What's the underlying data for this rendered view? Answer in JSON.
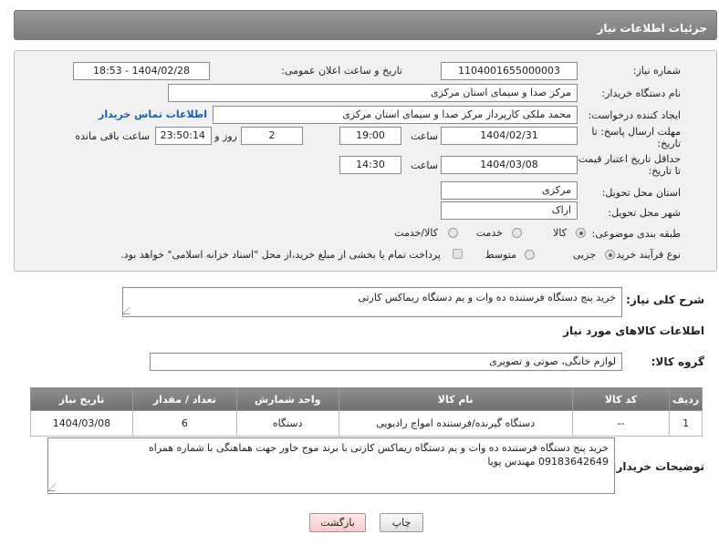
{
  "header": {
    "title": "جزئیات اطلاعات نیاز"
  },
  "form": {
    "need_number": {
      "label": "شماره نیاز:",
      "value": "1104001655000003"
    },
    "announce": {
      "label": "تاریخ و ساعت اعلان عمومی:",
      "value": "1404/02/28 - 18:53"
    },
    "buyer_org": {
      "label": "نام دستگاه خریدار:",
      "value": "مرکز صدا و سیمای استان مرکزی"
    },
    "requester": {
      "label": "ایجاد کننده درخواست:",
      "value": "محمد ملکی کارپرداز مرکز صدا و سیمای استان مرکزی",
      "contact_link": "اطلاعات تماس خریدار"
    },
    "reply_deadline": {
      "label_line1": "مهلت ارسال پاسخ: تا",
      "label_line2": "تاریخ:",
      "date": "1404/02/31",
      "time_label": "ساعت",
      "time": "19:00",
      "days": "2",
      "days_label": "روز و",
      "remaining": "23:50:14",
      "remaining_label": "ساعت باقی مانده"
    },
    "price_validity": {
      "label_line1": "حداقل تاریخ اعتبار قیمت:",
      "label_line2": "تا تاریخ:",
      "date": "1404/03/08",
      "time_label": "ساعت",
      "time": "14:30"
    },
    "province": {
      "label": "استان محل تحویل:",
      "value": "مرکزی"
    },
    "city": {
      "label": "شهر محل تحویل:",
      "value": "اراک"
    },
    "category": {
      "label": "طبقه بندی موضوعی:",
      "options": [
        "کالا",
        "خدمت",
        "کالا/خدمت"
      ],
      "selected": "کالا"
    },
    "purchase_type": {
      "label": "نوع فرآیند خرید :",
      "options": [
        "جزیی",
        "متوسط"
      ],
      "selected": "جزیی",
      "note": "پرداخت تمام یا بخشی از مبلغ خرید،از محل \"اسناد خزانه اسلامی\" خواهد بود."
    }
  },
  "description": {
    "label": "شرح کلی نیاز:",
    "value": "خرید پنج دستگاه فرستنده ده وات و یم دستگاه ریماکس کارتی"
  },
  "goods": {
    "section_title": "اطلاعات کالاهای مورد نیاز",
    "group_label": "گروه کالا:",
    "group_value": "لوازم خانگی، صوتی و تصویری",
    "columns": [
      "ردیف",
      "کد کالا",
      "نام کالا",
      "واحد شمارش",
      "تعداد / مقدار",
      "تاریخ نیاز"
    ],
    "rows": [
      [
        "1",
        "--",
        "دستگاه گیرنده/فرستنده امواج رادیویی",
        "دستگاه",
        "6",
        "1404/03/08"
      ]
    ]
  },
  "buyer_notes": {
    "label": "توضیحات خریدار:",
    "line1": "خرید پنج دستگاه فرستنده ده وات و یم دستگاه ریماکس کارتی با برند موج خاور جهت هماهنگی با شماره همراه",
    "line2": "09183642649 مهندس پویا"
  },
  "buttons": {
    "print": "چاپ",
    "back": "بازگشت"
  }
}
